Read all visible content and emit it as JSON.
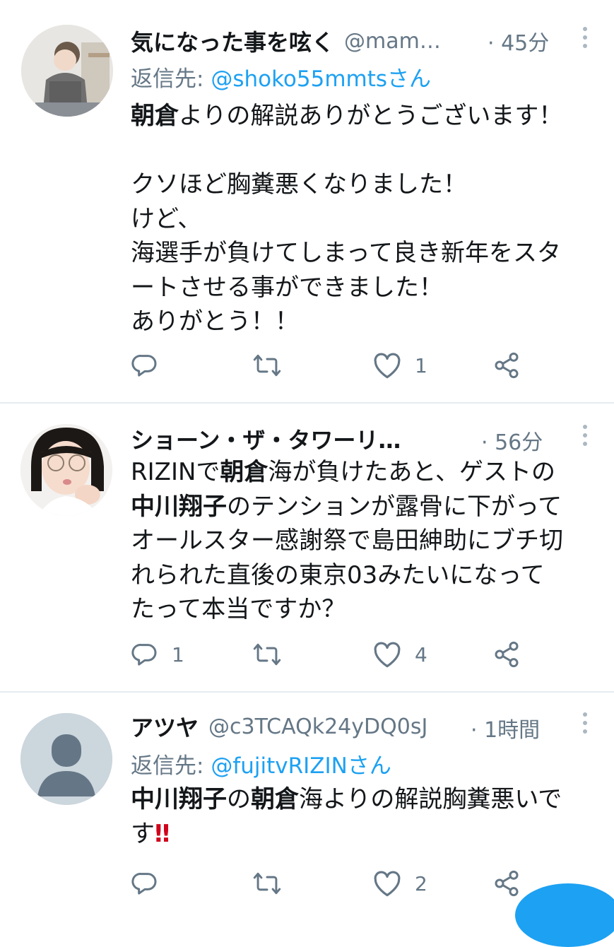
{
  "tweets": [
    {
      "name": "気になった事を呟く",
      "handle": "@mam…",
      "time": "· 45分",
      "reply_prefix": "返信先: ",
      "reply_to": "@shoko55mmtsさん",
      "lines": [
        [
          {
            "t": "朝倉",
            "b": true
          },
          {
            "t": "よりの解説ありがとうございます！"
          }
        ],
        [],
        [
          {
            "t": "クソほど胸糞悪くなりました！"
          }
        ],
        [
          {
            "t": "けど、"
          }
        ],
        [
          {
            "t": "海選手が負けてしまって良き新年をスタ"
          }
        ],
        [
          {
            "t": "ートさせる事ができました！"
          }
        ],
        [
          {
            "t": "ありがとう！！"
          }
        ]
      ],
      "reply_count": "",
      "retweet_count": "",
      "like_count": "1"
    },
    {
      "name": "ショーン・ザ・タワーリ…",
      "handle": "",
      "time": "· 56分",
      "reply_prefix": "",
      "reply_to": "",
      "lines": [
        [
          {
            "t": "RIZINで"
          },
          {
            "t": "朝倉",
            "b": true
          },
          {
            "t": "海が負けたあと、ゲストの"
          }
        ],
        [
          {
            "t": "中川翔子",
            "b": true
          },
          {
            "t": "のテンションが露骨に下がって"
          }
        ],
        [
          {
            "t": "オールスター感謝祭で島田紳助にブチ切"
          }
        ],
        [
          {
            "t": "れられた直後の東京03みたいになって"
          }
        ],
        [
          {
            "t": "たって本当ですか？"
          }
        ]
      ],
      "reply_count": "1",
      "retweet_count": "",
      "like_count": "4"
    },
    {
      "name": "アツヤ",
      "handle": "@c3TCAQk24yDQ0sJ",
      "time": "· 1時間",
      "reply_prefix": "返信先: ",
      "reply_to": "@fujitvRIZINさん",
      "lines": [
        [
          {
            "t": "中川翔子",
            "b": true
          },
          {
            "t": "の"
          },
          {
            "t": "朝倉",
            "b": true
          },
          {
            "t": "海よりの解説胸糞悪いで"
          }
        ],
        [
          {
            "t": "す"
          },
          {
            "t": "‼",
            "e": true
          }
        ]
      ],
      "reply_count": "",
      "retweet_count": "",
      "like_count": "2"
    }
  ],
  "colors": {
    "link": "#1da1f2",
    "meta": "#657786",
    "text": "#14171a",
    "divider": "#e6ecf0",
    "icon": "#657786"
  },
  "icons": {
    "reply": "reply-icon",
    "retweet": "retweet-icon",
    "like": "like-icon",
    "share": "share-icon",
    "more": "more-icon"
  }
}
